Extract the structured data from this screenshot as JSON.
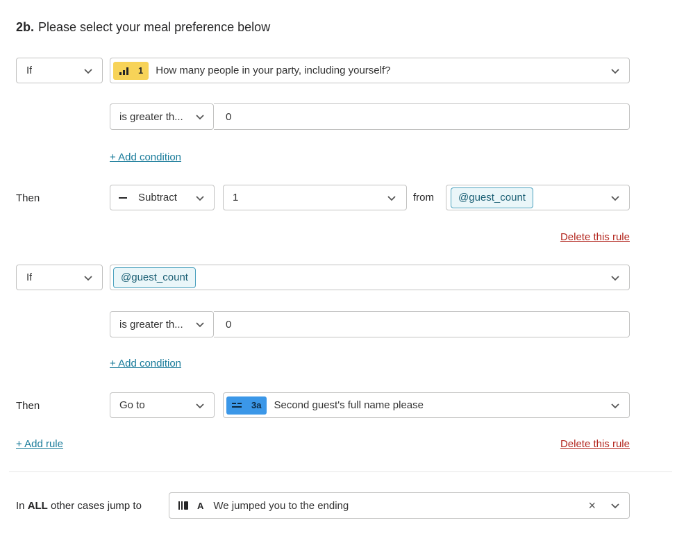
{
  "question": {
    "number": "2b.",
    "text": "Please select your meal preference below"
  },
  "rules": [
    {
      "if_label": "If",
      "subject": {
        "badge_number": "1",
        "badge_icon": "bar-chart-icon",
        "badge_color": "#f7d358",
        "text": "How many people in your party, including yourself?"
      },
      "operator": "is greater th...",
      "value": "0",
      "add_condition": "+ Add condition",
      "then_label": "Then",
      "action": "Subtract",
      "amount": "1",
      "from_label": "from",
      "target_variable": "@guest_count",
      "delete_label": "Delete this rule"
    },
    {
      "if_label": "If",
      "subject_variable": "@guest_count",
      "operator": "is greater th...",
      "value": "0",
      "add_condition": "+ Add condition",
      "then_label": "Then",
      "action": "Go to",
      "target": {
        "badge_number": "3a",
        "badge_icon": "short-text-icon",
        "badge_color": "#3b97e8",
        "text": "Second guest's full name please"
      },
      "delete_label": "Delete this rule"
    }
  ],
  "add_rule": "+ Add rule",
  "fallback": {
    "label_prefix": "In ",
    "label_bold": "ALL",
    "label_suffix": " other cases jump to",
    "badge_letter": "A",
    "badge_icon": "ending-icon",
    "text": "We jumped you to the ending",
    "clear_symbol": "×"
  },
  "colors": {
    "link": "#197b9a",
    "delete": "#b3261e",
    "variable_border": "#4aa0bd",
    "variable_bg": "#eaf6f9"
  }
}
